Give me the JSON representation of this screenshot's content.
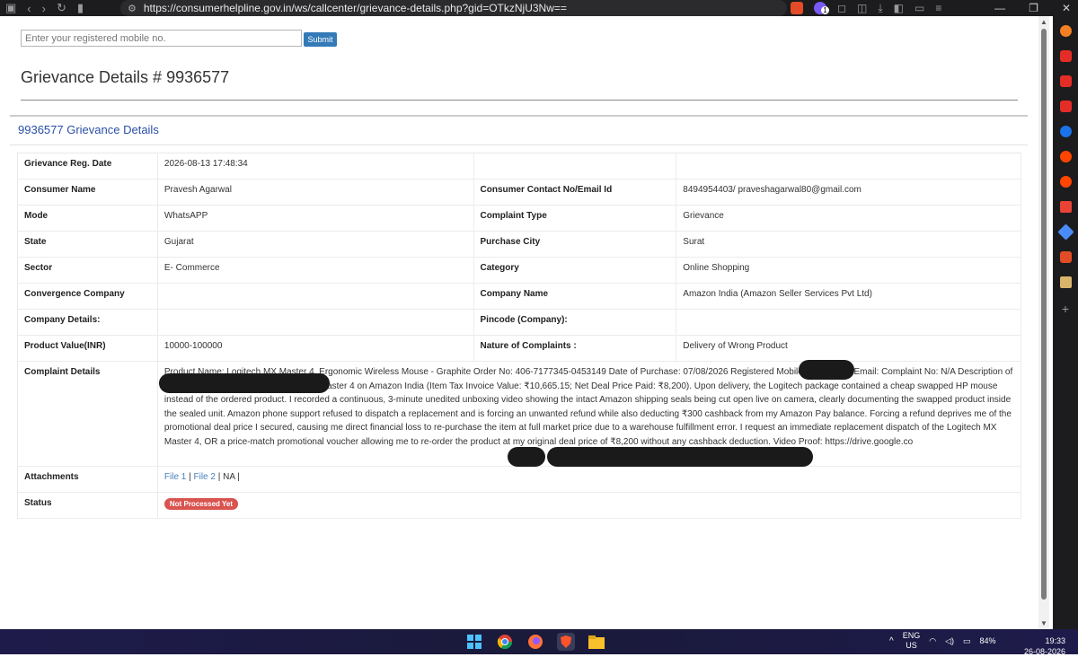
{
  "browser": {
    "url": "https://consumerhelpline.gov.in/ws/callcenter/grievance-details.php?gid=OTkzNjU3Nw==",
    "ext_badge": "1"
  },
  "search": {
    "placeholder": "Enter your registered mobile no.",
    "submit_label": "Submit"
  },
  "page": {
    "title": "Grievance Details # 9936577",
    "panel_heading": "9936577 Grievance Details"
  },
  "details": {
    "reg_date_label": "Grievance Reg. Date",
    "reg_date": "2026-08-13 17:48:34",
    "consumer_name_label": "Consumer Name",
    "consumer_name": "Pravesh Agarwal",
    "contact_label": "Consumer Contact No/Email Id",
    "contact": "8494954403/ praveshagarwal80@gmail.com",
    "mode_label": "Mode",
    "mode": "WhatsAPP",
    "complaint_type_label": "Complaint Type",
    "complaint_type": "Grievance",
    "state_label": "State",
    "state": "Gujarat",
    "purchase_city_label": "Purchase City",
    "purchase_city": "Surat",
    "sector_label": "Sector",
    "sector": "E- Commerce",
    "category_label": "Category",
    "category": "Online Shopping",
    "convergence_label": "Convergence Company",
    "convergence": "",
    "company_name_label": "Company Name",
    "company_name": "Amazon India (Amazon Seller Services Pvt Ltd)",
    "company_details_label": "Company Details:",
    "company_details": "",
    "pincode_label": "Pincode (Company):",
    "pincode": "",
    "product_value_label": "Product Value(INR)",
    "product_value": "10000-100000",
    "nature_label": "Nature of Complaints :",
    "nature": "Delivery of Wrong Product",
    "complaint_details_label": "Complaint Details",
    "complaint_details": "Product Name: Logitech MX Master 4, Ergonomic Wireless Mouse - Graphite Order No: 406-7177345-0453149 Date of Purchase: 07/08/2026 Registered Mobile: Registered Email: Complaint No: N/A Description of Grievance: I purchased a Logitech MX Master 4 on Amazon India (Item Tax Invoice Value: ₹10,665.15; Net Deal Price Paid: ₹8,200). Upon delivery, the Logitech package contained a cheap swapped HP mouse instead of the ordered product. I recorded a continuous, 3-minute unedited unboxing video showing the intact Amazon shipping seals being cut open live on camera, clearly documenting the swapped product inside the sealed unit. Amazon phone support refused to dispatch a replacement and is forcing an unwanted refund while also deducting ₹300 cashback from my Amazon Pay balance. Forcing a refund deprives me of the promotional deal price I secured, causing me direct financial loss to re-purchase the item at full market price due to a warehouse fulfillment error. I request an immediate replacement dispatch of the Logitech MX Master 4, OR a price-match promotional voucher allowing me to re-order the product at my original deal price of ₹8,200 without any cashback deduction. Video Proof: https://drive.google.co",
    "attachments_label": "Attachments",
    "file1": "File 1",
    "file2": "File 2",
    "na": "NA",
    "status_label": "Status",
    "status": "Not Processed Yet"
  },
  "taskbar": {
    "lang_top": "ENG",
    "lang_bottom": "US",
    "battery": "84%",
    "time": "19:33",
    "date": "26-08-2026"
  }
}
